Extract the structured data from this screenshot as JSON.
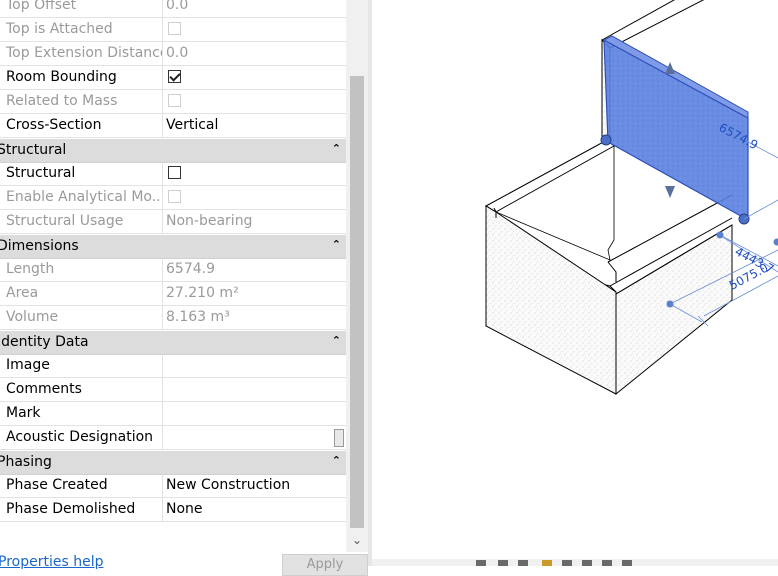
{
  "properties": {
    "rows": [
      {
        "name": "Top Offset",
        "value": "0.0",
        "disabled": true
      },
      {
        "name": "Top is Attached",
        "checkbox": true,
        "checked": false,
        "disabled": true
      },
      {
        "name": "Top Extension Distance",
        "value": "0.0",
        "disabled": true
      },
      {
        "name": "Room Bounding",
        "checkbox": true,
        "checked": true,
        "disabled": false
      },
      {
        "name": "Related to Mass",
        "checkbox": true,
        "checked": false,
        "disabled": true
      },
      {
        "name": "Cross-Section",
        "value": "Vertical",
        "disabled": false
      }
    ],
    "groups": {
      "structural": {
        "title": "Structural",
        "rows": [
          {
            "name": "Structural",
            "checkbox": true,
            "checked": false,
            "disabled": false
          },
          {
            "name": "Enable Analytical Mo...",
            "checkbox": true,
            "checked": false,
            "disabled": true
          },
          {
            "name": "Structural Usage",
            "value": "Non-bearing",
            "disabled": true
          }
        ]
      },
      "dimensions": {
        "title": "Dimensions",
        "rows": [
          {
            "name": "Length",
            "value": "6574.9",
            "disabled": true
          },
          {
            "name": "Area",
            "value": "27.210 m²",
            "disabled": true
          },
          {
            "name": "Volume",
            "value": "8.163 m³",
            "disabled": true
          }
        ]
      },
      "identity": {
        "title": "Identity Data",
        "rows": [
          {
            "name": "Image",
            "value": "",
            "disabled": false
          },
          {
            "name": "Comments",
            "value": "",
            "disabled": false
          },
          {
            "name": "Mark",
            "value": "",
            "disabled": false
          },
          {
            "name": "Acoustic Designation",
            "value": "",
            "disabled": false
          }
        ]
      },
      "phasing": {
        "title": "Phasing",
        "rows": [
          {
            "name": "Phase Created",
            "value": "New Construction",
            "disabled": false
          },
          {
            "name": "Phase Demolished",
            "value": "None",
            "disabled": false
          }
        ]
      }
    },
    "collapse_glyph": "⌃",
    "scroll_down_glyph": "⌄"
  },
  "footer": {
    "help_link": "Properties help",
    "apply_label": "Apply"
  },
  "view": {
    "dimensions": {
      "wall_length": "6574.9",
      "dim_a": "4443.7",
      "dim_b": "5075.0"
    },
    "selection_color": "#4a6fd8"
  },
  "colors": {
    "group_header": "#dcdcdc",
    "disabled_text": "#9a9a9a",
    "link": "#1a66c9",
    "dimension": "#1f4fc1"
  }
}
